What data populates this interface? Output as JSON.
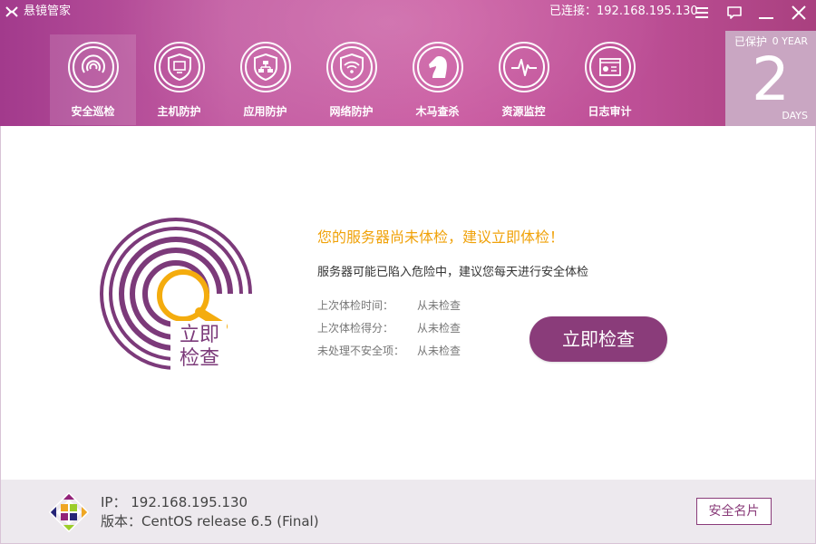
{
  "app": {
    "title": "悬镜管家",
    "logo_icon": "app-logo-icon"
  },
  "connection": {
    "text": "已连接：192.168.195.130"
  },
  "window_controls": [
    {
      "name": "menu-icon"
    },
    {
      "name": "feedback-icon"
    },
    {
      "name": "minimize-icon"
    },
    {
      "name": "close-icon"
    }
  ],
  "nav": {
    "items": [
      {
        "label": "安全巡检",
        "icon": "radar-icon",
        "active": true
      },
      {
        "label": "主机防护",
        "icon": "host-shield-icon",
        "active": false
      },
      {
        "label": "应用防护",
        "icon": "app-shield-icon",
        "active": false
      },
      {
        "label": "网络防护",
        "icon": "wifi-shield-icon",
        "active": false
      },
      {
        "label": "木马查杀",
        "icon": "horse-icon",
        "active": false
      },
      {
        "label": "资源监控",
        "icon": "pulse-icon",
        "active": false
      },
      {
        "label": "日志审计",
        "icon": "log-icon",
        "active": false
      }
    ]
  },
  "protection": {
    "label": "已保护",
    "year": "0 YEAR",
    "days": "2",
    "unit": "DAYS"
  },
  "main": {
    "badge_line1": "立即",
    "badge_line2": "检查",
    "headline": "您的服务器尚未体检，建议立即体检！",
    "subline": "服务器可能已陷入危险中，建议您每天进行安全体检",
    "stats": [
      {
        "label": "上次体检时间：",
        "value": "从未检查"
      },
      {
        "label": "上次体检得分：",
        "value": "从未检查"
      },
      {
        "label": "未处理不安全项：",
        "value": "从未检查"
      }
    ],
    "check_button": "立即检查"
  },
  "footer": {
    "ip": "IP： 192.168.195.130",
    "version": "版本：CentOS release 6.5 (Final)",
    "card_button": "安全名片",
    "os_icon": "centos-logo-icon"
  },
  "colors": {
    "brand": "#a23a8c",
    "accent": "#f0a20a",
    "button": "#8a3c7a"
  }
}
